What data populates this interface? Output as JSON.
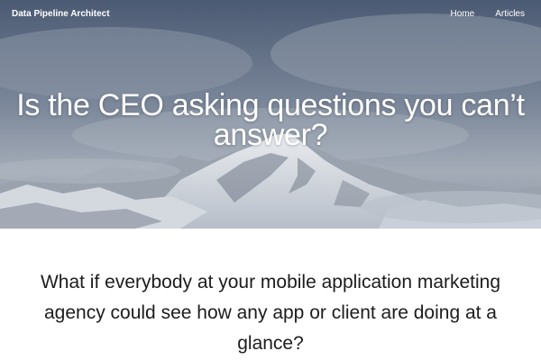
{
  "nav": {
    "brand": "Data Pipeline Architect",
    "links": [
      {
        "label": "Home"
      },
      {
        "label": "Articles"
      }
    ]
  },
  "hero": {
    "title": "Is the CEO asking questions you can’t answer?",
    "background": "snowy-mountain-photo"
  },
  "content": {
    "lead": "What if everybody at your mobile application marketing agency could see how any app or client are doing at a glance?"
  },
  "colors": {
    "nav_text": "#ffffff",
    "hero_text": "#ffffff",
    "body_text": "#1c1c1c",
    "page_background": "#ffffff"
  }
}
